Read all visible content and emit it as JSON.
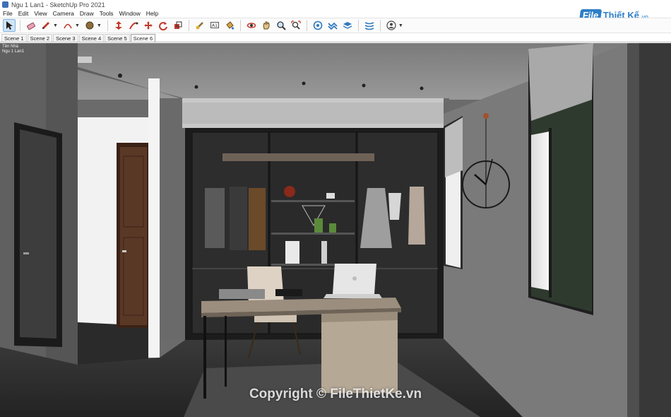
{
  "window": {
    "title": "Ngu 1 Lan1 - SketchUp Pro 2021"
  },
  "menu": [
    "File",
    "Edit",
    "View",
    "Camera",
    "Draw",
    "Tools",
    "Window",
    "Help"
  ],
  "toolbar": {
    "tools": [
      {
        "name": "select-tool",
        "icon": "arrow-cursor-icon",
        "active": true
      },
      {
        "name": "eraser-tool",
        "icon": "eraser-icon"
      },
      {
        "name": "line-tool",
        "icon": "pencil-icon"
      },
      {
        "name": "arc-tool",
        "icon": "arc-icon"
      },
      {
        "name": "shape-tool",
        "icon": "circle-shape-icon"
      },
      {
        "name": "push-pull-tool",
        "icon": "push-pull-icon"
      },
      {
        "name": "follow-me-tool",
        "icon": "follow-me-icon"
      },
      {
        "name": "move-tool",
        "icon": "move-icon"
      },
      {
        "name": "rotate-tool",
        "icon": "rotate-icon"
      },
      {
        "name": "scale-tool",
        "icon": "scale-icon"
      },
      {
        "name": "tape-measure-tool",
        "icon": "tape-measure-icon"
      },
      {
        "name": "text-tool",
        "icon": "text-icon"
      },
      {
        "name": "paint-bucket-tool",
        "icon": "paint-bucket-icon"
      },
      {
        "name": "orbit-tool",
        "icon": "orbit-icon"
      },
      {
        "name": "pan-tool",
        "icon": "hand-icon"
      },
      {
        "name": "zoom-tool",
        "icon": "magnifier-icon"
      },
      {
        "name": "zoom-extents-tool",
        "icon": "zoom-extents-icon"
      },
      {
        "name": "3d-warehouse-tool",
        "icon": "warehouse-icon"
      },
      {
        "name": "extension-tool",
        "icon": "extension-icon"
      },
      {
        "name": "layers-tool",
        "icon": "layers-icon"
      },
      {
        "name": "styles-tool",
        "icon": "styles-icon"
      },
      {
        "name": "account-tool",
        "icon": "account-icon"
      }
    ]
  },
  "logo": {
    "badge": "File",
    "name": "Thiết Kế",
    "suffix": ".vn"
  },
  "scenes": [
    "Scene 1",
    "Scene 2",
    "Scene 3",
    "Scene 4",
    "Scene 5",
    "Scene 6"
  ],
  "active_scene": "Scene 6",
  "viewport": {
    "mini_label_1": "Tên Nhà",
    "mini_label_2": "Ngu 1 Lan1"
  },
  "watermark": "Copyright © FileThietKe.vn",
  "colors": {
    "accent": "#2e7fc8",
    "wall": "#6b6b6b",
    "ceiling": "#8a8a8a",
    "floor": "#2d2d2d",
    "wardrobe": "#1c1c1c",
    "desk": "#9b8e7e",
    "door": "#5a3826"
  }
}
